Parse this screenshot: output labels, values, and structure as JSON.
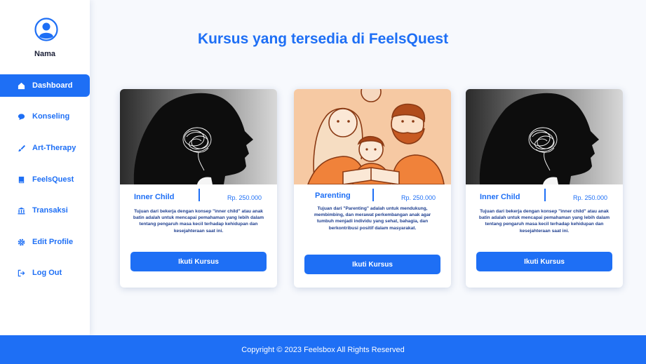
{
  "user": {
    "name": "Nama"
  },
  "sidebar": {
    "items": [
      {
        "label": "Dashboard",
        "icon": "home-icon",
        "active": true
      },
      {
        "label": "Konseling",
        "icon": "chat-bubble-icon"
      },
      {
        "label": "Art-Therapy",
        "icon": "paintbrush-icon"
      },
      {
        "label": "FeelsQuest",
        "icon": "book-icon"
      },
      {
        "label": "Transaksi",
        "icon": "bank-icon"
      },
      {
        "label": "Edit Profile",
        "icon": "gear-icon"
      },
      {
        "label": "Log Out",
        "icon": "logout-icon"
      }
    ]
  },
  "main": {
    "title": "Kursus yang tersedia di FeelsQuest"
  },
  "courses": [
    {
      "title": "Inner Child",
      "price": "Rp. 250.000",
      "description": "Tujuan dari bekerja dengan konsep \"inner child\" atau anak batin adalah untuk mencapai pemahaman yang lebih dalam tentang pengaruh masa kecil terhadap kehidupan dan kesejahteraan saat ini.",
      "button": "Ikuti Kursus",
      "image": "woman-silhouette-tangled-mind-image"
    },
    {
      "title": "Parenting",
      "price": "Rp. 250.000",
      "description": "Tujuan dari \"Parenting\" adalah untuk mendukung, membimbing, dan merawat perkembangan anak agar tumbuh menjadi individu yang sehat, bahagia, dan berkontribusi positif dalam masyarakat.",
      "button": "Ikuti Kursus",
      "image": "family-reading-illustration-image"
    },
    {
      "title": "Inner Child",
      "price": "Rp. 250.000",
      "description": "Tujuan dari bekerja dengan konsep \"inner child\" atau anak batin adalah untuk mencapai pemahaman yang lebih dalam tentang pengaruh masa kecil terhadap kehidupan dan kesejahteraan saat ini.",
      "button": "Ikuti Kursus",
      "image": "woman-silhouette-tangled-mind-image"
    }
  ],
  "footer": {
    "text": "Copyright © 2023 Feelsbox All Rights Reserved"
  },
  "colors": {
    "accent": "#1e6ff5",
    "orange": "#f0823a"
  }
}
